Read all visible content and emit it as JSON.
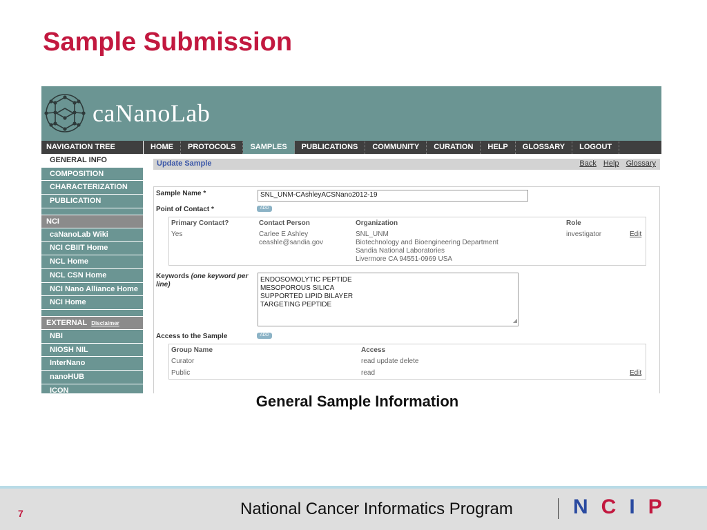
{
  "slide": {
    "title": "Sample Submission",
    "caption": "General Sample Information",
    "page_number": "7",
    "footer_org": "National Cancer Informatics Program",
    "footer_logo": [
      "N",
      "C",
      "I",
      "P"
    ]
  },
  "app": {
    "logo_text": "caNanoLab",
    "nav_tree_label": "NAVIGATION TREE",
    "top_nav": [
      "HOME",
      "PROTOCOLS",
      "SAMPLES",
      "PUBLICATIONS",
      "COMMUNITY",
      "CURATION",
      "HELP",
      "GLOSSARY",
      "LOGOUT"
    ],
    "top_nav_active": "SAMPLES",
    "sidebar": {
      "main": [
        "GENERAL INFO",
        "COMPOSITION",
        "CHARACTERIZATION",
        "PUBLICATION"
      ],
      "nci_head": "NCI",
      "nci": [
        "caNanoLab Wiki",
        "NCI CBIIT Home",
        "NCL Home",
        "NCL CSN Home",
        "NCI Nano Alliance Home",
        "NCI Home"
      ],
      "external_head": "EXTERNAL",
      "disclaimer": "Disclaimer",
      "external": [
        "NBI",
        "NIOSH NIL",
        "InterNano",
        "nanoHUB",
        "ICON"
      ]
    },
    "subbar": {
      "title": "Update Sample",
      "links": [
        "Back",
        "Help",
        "Glossary"
      ]
    },
    "form": {
      "sample_name_label": "Sample Name *",
      "sample_name_value": "SNL_UNM-CAshleyACSNano2012-19",
      "poc_label": "Point of Contact *",
      "add_label": "ADD",
      "poc_table": {
        "headers": [
          "Primary Contact?",
          "Contact Person",
          "Organization",
          "Role"
        ],
        "primary": "Yes",
        "person": [
          "Carlee E Ashley",
          "ceashle@sandia.gov"
        ],
        "organization": [
          "SNL_UNM",
          "Biotechnology and Bioengineering Department",
          "Sandia National Laboratories",
          "Livermore CA 94551-0969 USA"
        ],
        "role": "investigator",
        "edit": "Edit"
      },
      "keywords_label": "Keywords",
      "keywords_hint": "(one keyword per line)",
      "keywords": [
        "ENDOSOMOLYTIC PEPTIDE",
        "MESOPOROUS SILICA",
        "SUPPORTED LIPID BILAYER",
        "TARGETING PEPTIDE"
      ],
      "access_label": "Access to the Sample",
      "access_table": {
        "headers": [
          "Group Name",
          "Access"
        ],
        "rows": [
          {
            "group": "Curator",
            "access": "read update delete"
          },
          {
            "group": "Public",
            "access": "read"
          }
        ],
        "edit": "Edit"
      }
    }
  },
  "colors": {
    "title_red": "#c2183f",
    "teal": "#6b9593",
    "dark_nav": "#3f3f3f",
    "link_blue": "#3a56a8"
  }
}
